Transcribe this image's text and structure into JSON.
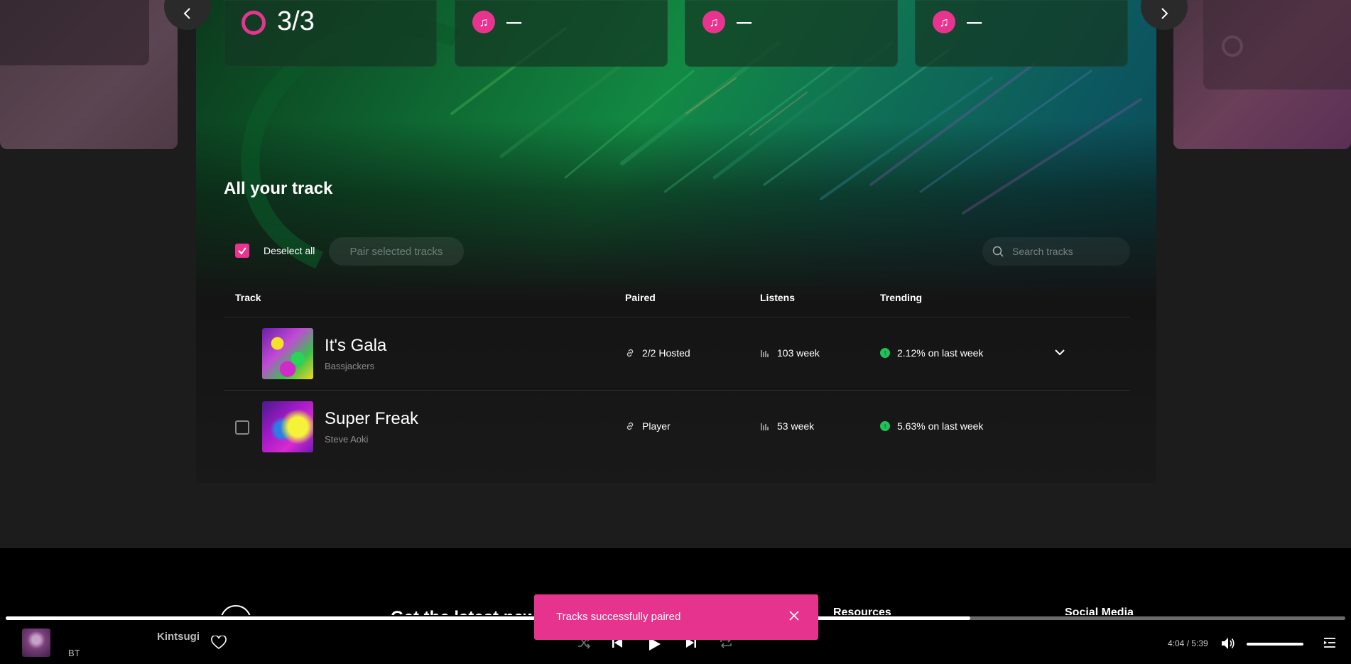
{
  "stats": {
    "paired": "3/3",
    "card2": "–",
    "card3": "–",
    "card4": "–"
  },
  "section": {
    "title": "All your track"
  },
  "toolbar": {
    "deselect_label": "Deselect all",
    "pair_label": "Pair selected tracks",
    "search_placeholder": "Search tracks"
  },
  "table": {
    "headers": {
      "track": "Track",
      "paired": "Paired",
      "listens": "Listens",
      "trending": "Trending"
    },
    "rows": [
      {
        "title": "It's Gala",
        "artist": "Bassjackers",
        "paired": "2/2 Hosted",
        "listens": "103 week",
        "trending": "2.12% on last week"
      },
      {
        "title": "Super Freak",
        "artist": "Steve Aoki",
        "paired": "Player",
        "listens": "53 week",
        "trending": "5.63% on last week"
      }
    ]
  },
  "footer": {
    "heading": "Get the latest new",
    "resources": "Resources",
    "social": "Social Media"
  },
  "player": {
    "title": "Kintsugi",
    "artist": "BT",
    "time": "4:04 / 5:39",
    "progress": 0.72
  },
  "toast": {
    "message": "Tracks successfully paired"
  },
  "colors": {
    "accent": "#e5338e",
    "trend_up": "#1fc25a"
  }
}
